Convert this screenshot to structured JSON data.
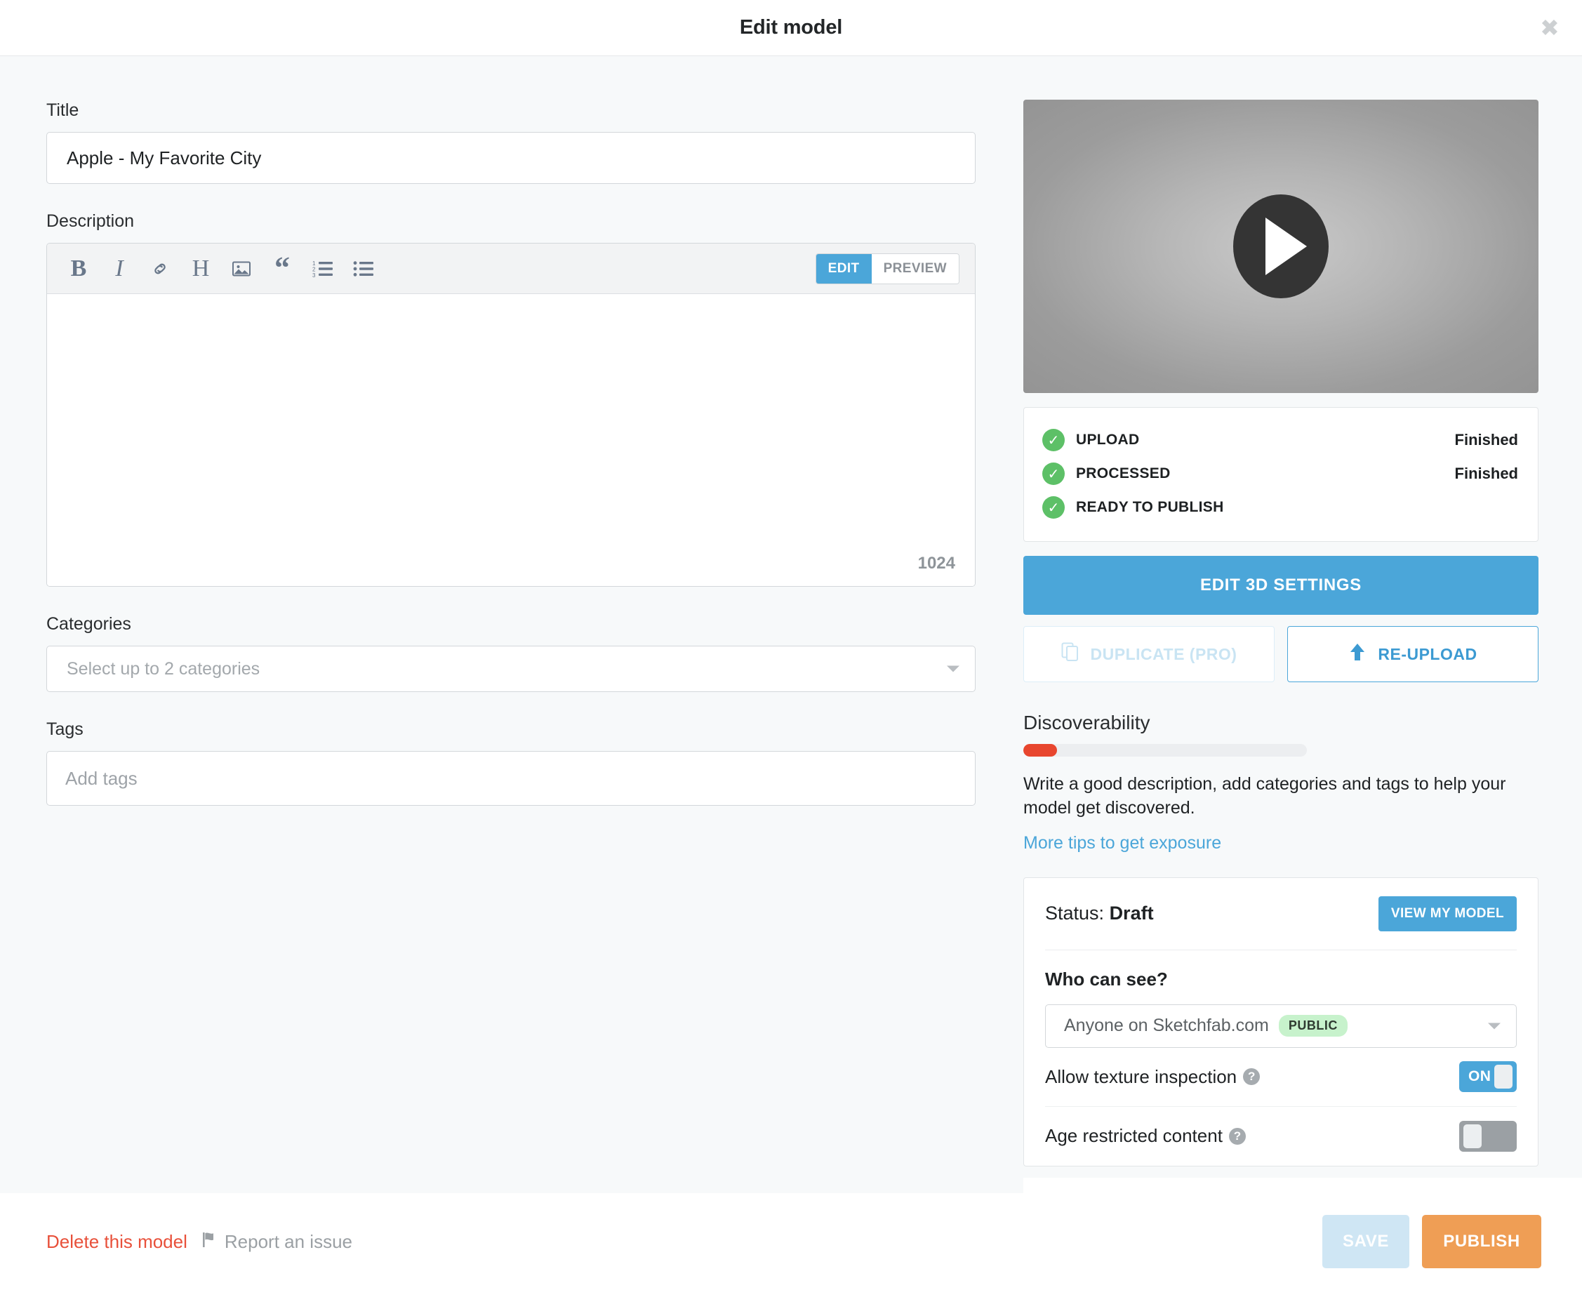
{
  "header": {
    "title": "Edit model",
    "close_label": "✖"
  },
  "form": {
    "title_label": "Title",
    "title_value": "Apple - My Favorite City",
    "title_placeholder": "",
    "description_label": "Description",
    "description_value": "",
    "description_placeholder": "",
    "char_count": "1024",
    "editor_modes": [
      {
        "label": "EDIT",
        "active": true
      },
      {
        "label": "PREVIEW",
        "active": false
      }
    ],
    "toolbar_icons": [
      "bold-icon",
      "italic-icon",
      "link-icon",
      "heading-icon",
      "image-icon",
      "quote-icon",
      "ordered-list-icon",
      "unordered-list-icon"
    ],
    "categories_label": "Categories",
    "categories_placeholder": "Select up to 2 categories",
    "tags_label": "Tags",
    "tags_value": "",
    "tags_placeholder": "Add tags"
  },
  "preview": {
    "play_icon": "play-icon"
  },
  "status_card": {
    "rows": [
      {
        "name": "UPLOAD",
        "value": "Finished",
        "check": "✓"
      },
      {
        "name": "PROCESSED",
        "value": "Finished",
        "check": "✓"
      },
      {
        "name": "READY TO PUBLISH",
        "value": "",
        "check": "✓"
      }
    ]
  },
  "actions": {
    "edit_3d_settings": "EDIT 3D SETTINGS",
    "duplicate": "DUPLICATE (PRO)",
    "reupload": "RE-UPLOAD"
  },
  "discoverability": {
    "title": "Discoverability",
    "progress_percent": 12,
    "text": "Write a good description, add categories and tags to help your model get discovered.",
    "link": "More tips to get exposure"
  },
  "settings": {
    "status_prefix": "Status:",
    "status_value": "Draft",
    "view_model_button": "VIEW MY MODEL",
    "who_can_see_label": "Who can see?",
    "who_can_see_value": "Anyone on Sketchfab.com",
    "who_can_see_badge": "PUBLIC",
    "toggles": [
      {
        "label": "Allow texture inspection",
        "state": "ON",
        "on": true
      },
      {
        "label": "Age restricted content",
        "state": "",
        "on": false
      }
    ]
  },
  "footer": {
    "delete_link": "Delete this model",
    "report_link": "Report an issue",
    "save_button": "SAVE",
    "publish_button": "PUBLISH"
  },
  "colors": {
    "accent_blue": "#4ba6d9",
    "publish_orange": "#ef9e55",
    "danger_red": "#e8503a",
    "progress_red": "#e8462e",
    "success_green": "#5dc067",
    "badge_green_bg": "#c7f2cc",
    "page_bg": "#f7f9fa"
  }
}
